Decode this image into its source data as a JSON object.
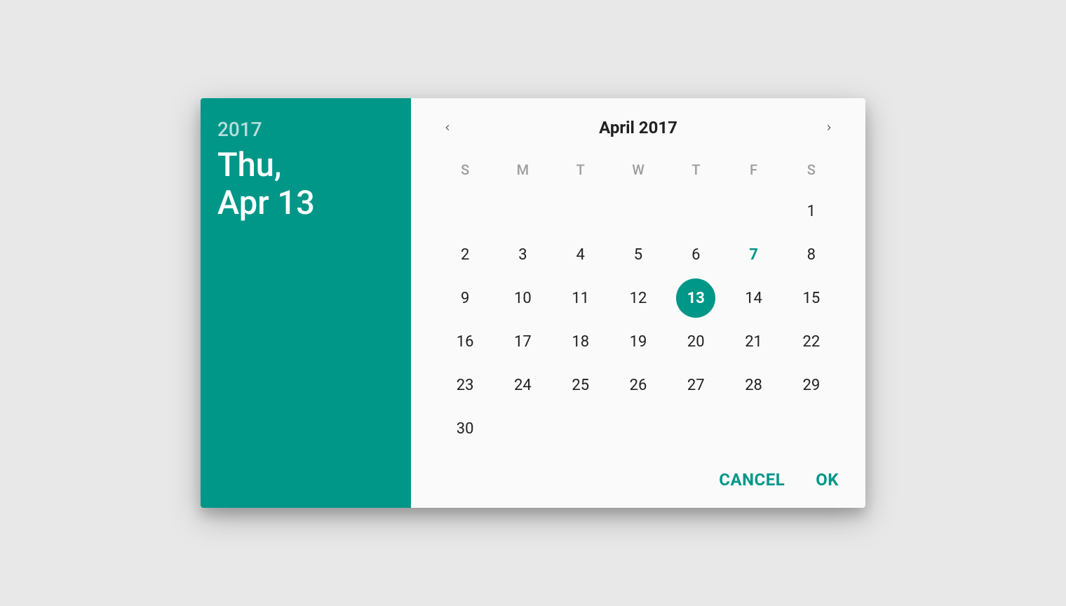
{
  "colors": {
    "accent": "#009688"
  },
  "sidebar": {
    "year": "2017",
    "date_line1": "Thu,",
    "date_line2": "Apr 13"
  },
  "calendar": {
    "month_label": "April 2017",
    "dow": [
      "S",
      "M",
      "T",
      "W",
      "T",
      "F",
      "S"
    ],
    "weeks": [
      [
        "",
        "",
        "",
        "",
        "",
        "",
        "1"
      ],
      [
        "2",
        "3",
        "4",
        "5",
        "6",
        "7",
        "8"
      ],
      [
        "9",
        "10",
        "11",
        "12",
        "13",
        "14",
        "15"
      ],
      [
        "16",
        "17",
        "18",
        "19",
        "20",
        "21",
        "22"
      ],
      [
        "23",
        "24",
        "25",
        "26",
        "27",
        "28",
        "29"
      ],
      [
        "30",
        "",
        "",
        "",
        "",
        "",
        ""
      ]
    ],
    "today": "7",
    "selected": "13"
  },
  "actions": {
    "cancel": "CANCEL",
    "ok": "OK"
  }
}
